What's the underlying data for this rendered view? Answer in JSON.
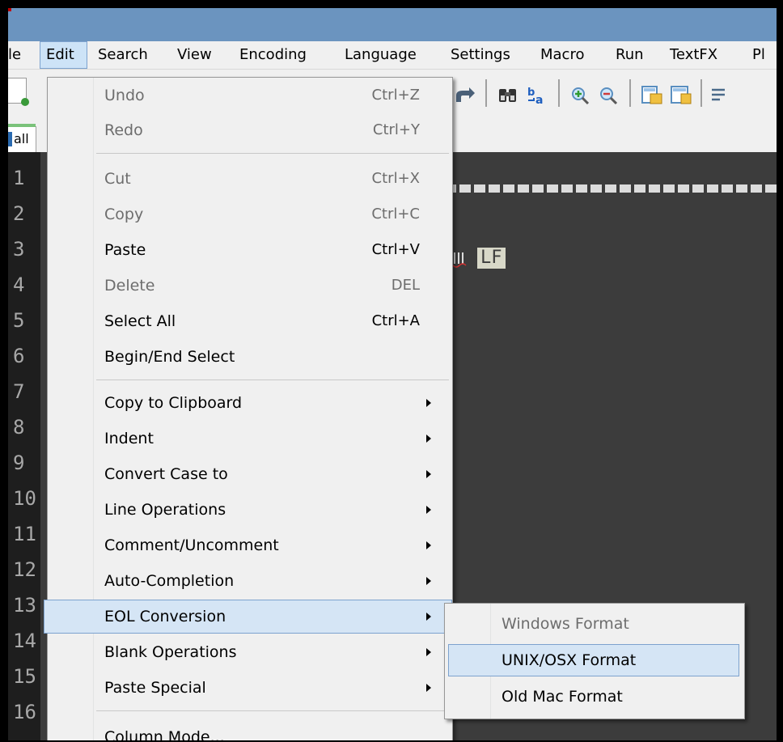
{
  "menubar": {
    "items": [
      "le",
      "Edit",
      "Search",
      "View",
      "Encoding",
      "Language",
      "Settings",
      "Macro",
      "Run",
      "TextFX",
      "Pl"
    ]
  },
  "tab": {
    "label": "all"
  },
  "gutter": {
    "line_numbers": [
      "1",
      "2",
      "3",
      "4",
      "5",
      "6",
      "7",
      "8",
      "9",
      "10",
      "11",
      "12",
      "13",
      "14",
      "15",
      "16"
    ]
  },
  "editor": {
    "eol_marker": "LF"
  },
  "edit_menu": {
    "items": [
      {
        "label": "Undo",
        "shortcut": "Ctrl+Z"
      },
      {
        "label": "Redo",
        "shortcut": "Ctrl+Y"
      },
      {
        "label": "Cut",
        "shortcut": "Ctrl+X"
      },
      {
        "label": "Copy",
        "shortcut": "Ctrl+C"
      },
      {
        "label": "Paste",
        "shortcut": "Ctrl+V"
      },
      {
        "label": "Delete",
        "shortcut": "DEL"
      },
      {
        "label": "Select All",
        "shortcut": "Ctrl+A"
      },
      {
        "label": "Begin/End Select",
        "shortcut": ""
      },
      {
        "label": "Copy to Clipboard",
        "shortcut": ""
      },
      {
        "label": "Indent",
        "shortcut": ""
      },
      {
        "label": "Convert Case to",
        "shortcut": ""
      },
      {
        "label": "Line Operations",
        "shortcut": ""
      },
      {
        "label": "Comment/Uncomment",
        "shortcut": ""
      },
      {
        "label": "Auto-Completion",
        "shortcut": ""
      },
      {
        "label": "EOL Conversion",
        "shortcut": ""
      },
      {
        "label": "Blank Operations",
        "shortcut": ""
      },
      {
        "label": "Paste Special",
        "shortcut": ""
      },
      {
        "label": "Column Mode...",
        "shortcut": ""
      }
    ]
  },
  "eol_submenu": {
    "items": [
      {
        "label": "Windows Format"
      },
      {
        "label": "UNIX/OSX Format"
      },
      {
        "label": "Old Mac Format"
      }
    ]
  },
  "colors": {
    "titlebar": "#6b94bf",
    "menu_bg": "#f0f0f0",
    "highlight_bg": "#d5e5f5",
    "highlight_border": "#7da2ce",
    "editor_bg": "#3c3c3c",
    "disabled_text": "#6d6d6d"
  }
}
